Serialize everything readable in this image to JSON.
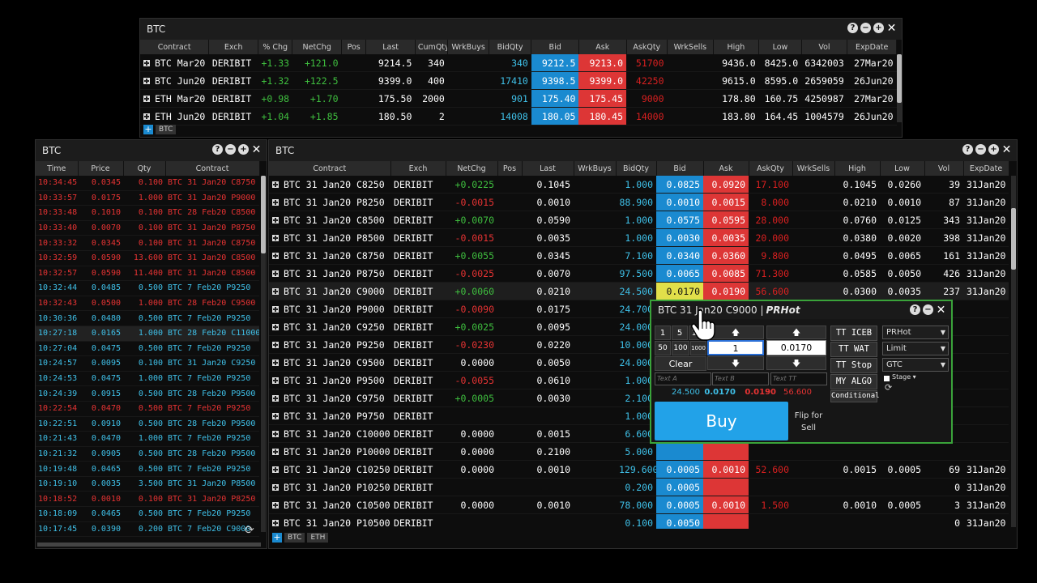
{
  "top_window": {
    "title": "BTC",
    "headers": [
      "Contract",
      "Exch",
      "% Chg",
      "NetChg",
      "Pos",
      "Last",
      "CumQty",
      "WrkBuys",
      "BidQty",
      "Bid",
      "Ask",
      "AskQty",
      "WrkSells",
      "High",
      "Low",
      "Vol",
      "ExpDate"
    ],
    "rows": [
      [
        "BTC Mar20",
        "DERIBIT",
        "+1.33",
        "+121.0",
        "",
        "9214.5",
        "340",
        "",
        "340",
        "9212.5",
        "9213.0",
        "51700",
        "",
        "9436.0",
        "8425.0",
        "6342003",
        "27Mar20"
      ],
      [
        "BTC Jun20",
        "DERIBIT",
        "+1.32",
        "+122.5",
        "",
        "9399.0",
        "400",
        "",
        "17410",
        "9398.5",
        "9399.0",
        "42250",
        "",
        "9615.0",
        "8595.0",
        "2659059",
        "26Jun20"
      ],
      [
        "ETH Mar20",
        "DERIBIT",
        "+0.98",
        "+1.70",
        "",
        "175.50",
        "2000",
        "",
        "901",
        "175.40",
        "175.45",
        "9000",
        "",
        "178.80",
        "160.75",
        "4250987",
        "27Mar20"
      ],
      [
        "ETH Jun20",
        "DERIBIT",
        "+1.04",
        "+1.85",
        "",
        "180.50",
        "2",
        "",
        "14008",
        "180.05",
        "180.45",
        "14000",
        "",
        "183.80",
        "164.45",
        "1004579",
        "26Jun20"
      ]
    ],
    "tabs": [
      "BTC"
    ]
  },
  "trades_window": {
    "title": "BTC",
    "headers": [
      "Time",
      "Price",
      "Qty",
      "Contract"
    ],
    "rows": [
      [
        "10:34:45",
        "0.0345",
        "0.100",
        "BTC 31 Jan20 C8750",
        "red"
      ],
      [
        "10:33:57",
        "0.0175",
        "1.000",
        "BTC 31 Jan20 P9000",
        "red"
      ],
      [
        "10:33:48",
        "0.1010",
        "0.100",
        "BTC 28 Feb20 C8500",
        "red"
      ],
      [
        "10:33:40",
        "0.0070",
        "0.100",
        "BTC 31 Jan20 P8750",
        "red"
      ],
      [
        "10:33:32",
        "0.0345",
        "0.100",
        "BTC 31 Jan20 C8750",
        "red"
      ],
      [
        "10:32:59",
        "0.0590",
        "13.600",
        "BTC 31 Jan20 C8500",
        "red"
      ],
      [
        "10:32:57",
        "0.0590",
        "11.400",
        "BTC 31 Jan20 C8500",
        "red"
      ],
      [
        "10:32:44",
        "0.0485",
        "0.500",
        "BTC 7 Feb20 P9250",
        "cy"
      ],
      [
        "10:32:43",
        "0.0500",
        "1.000",
        "BTC 28 Feb20 C9500",
        "red"
      ],
      [
        "10:30:36",
        "0.0480",
        "0.500",
        "BTC 7 Feb20 P9250",
        "cy"
      ],
      [
        "10:27:18",
        "0.0165",
        "1.000",
        "BTC 28 Feb20 C11000",
        "cy"
      ],
      [
        "10:27:04",
        "0.0475",
        "0.500",
        "BTC 7 Feb20 P9250",
        "cy"
      ],
      [
        "10:24:57",
        "0.0095",
        "0.100",
        "BTC 31 Jan20 C9250",
        "cy"
      ],
      [
        "10:24:53",
        "0.0475",
        "1.000",
        "BTC 7 Feb20 P9250",
        "cy"
      ],
      [
        "10:24:39",
        "0.0915",
        "0.500",
        "BTC 28 Feb20 P9500",
        "cy"
      ],
      [
        "10:22:54",
        "0.0470",
        "0.500",
        "BTC 7 Feb20 P9250",
        "red"
      ],
      [
        "10:22:51",
        "0.0910",
        "0.500",
        "BTC 28 Feb20 P9500",
        "cy"
      ],
      [
        "10:21:43",
        "0.0470",
        "1.000",
        "BTC 7 Feb20 P9250",
        "cy"
      ],
      [
        "10:21:32",
        "0.0905",
        "0.500",
        "BTC 28 Feb20 P9500",
        "cy"
      ],
      [
        "10:19:48",
        "0.0465",
        "0.500",
        "BTC 7 Feb20 P9250",
        "cy"
      ],
      [
        "10:19:10",
        "0.0035",
        "3.500",
        "BTC 31 Jan20 P8500",
        "cy"
      ],
      [
        "10:18:52",
        "0.0010",
        "0.100",
        "BTC 31 Jan20 P8250",
        "red"
      ],
      [
        "10:18:09",
        "0.0465",
        "0.500",
        "BTC 7 Feb20 P9250",
        "cy"
      ],
      [
        "10:17:45",
        "0.0390",
        "0.200",
        "BTC 7 Feb20 C9000",
        "cy"
      ]
    ]
  },
  "options_window": {
    "title": "BTC",
    "headers": [
      "Contract",
      "Exch",
      "NetChg",
      "Pos",
      "Last",
      "WrkBuys",
      "BidQty",
      "Bid",
      "Ask",
      "AskQty",
      "WrkSells",
      "High",
      "Low",
      "Vol",
      "ExpDate"
    ],
    "rows": [
      [
        "BTC 31 Jan20 C8250",
        "DERIBIT",
        "+0.0225",
        "",
        "0.1045",
        "",
        "1.000",
        "0.0825",
        "0.0920",
        "17.100",
        "",
        "0.1045",
        "0.0260",
        "39",
        "31Jan20"
      ],
      [
        "BTC 31 Jan20 P8250",
        "DERIBIT",
        "-0.0015",
        "",
        "0.0010",
        "",
        "88.900",
        "0.0010",
        "0.0015",
        "8.000",
        "",
        "0.0210",
        "0.0010",
        "87",
        "31Jan20"
      ],
      [
        "BTC 31 Jan20 C8500",
        "DERIBIT",
        "+0.0070",
        "",
        "0.0590",
        "",
        "1.000",
        "0.0575",
        "0.0595",
        "28.000",
        "",
        "0.0760",
        "0.0125",
        "343",
        "31Jan20"
      ],
      [
        "BTC 31 Jan20 P8500",
        "DERIBIT",
        "-0.0015",
        "",
        "0.0035",
        "",
        "1.000",
        "0.0030",
        "0.0035",
        "20.000",
        "",
        "0.0380",
        "0.0020",
        "398",
        "31Jan20"
      ],
      [
        "BTC 31 Jan20 C8750",
        "DERIBIT",
        "+0.0055",
        "",
        "0.0345",
        "",
        "7.100",
        "0.0340",
        "0.0360",
        "9.800",
        "",
        "0.0495",
        "0.0065",
        "161",
        "31Jan20"
      ],
      [
        "BTC 31 Jan20 P8750",
        "DERIBIT",
        "-0.0025",
        "",
        "0.0070",
        "",
        "97.500",
        "0.0065",
        "0.0085",
        "71.300",
        "",
        "0.0585",
        "0.0050",
        "426",
        "31Jan20"
      ],
      [
        "BTC 31 Jan20 C9000",
        "DERIBIT",
        "+0.0060",
        "",
        "0.0210",
        "",
        "24.500",
        "0.0170",
        "0.0190",
        "56.600",
        "",
        "0.0300",
        "0.0035",
        "237",
        "31Jan20"
      ],
      [
        "BTC 31 Jan20 P9000",
        "DERIBIT",
        "-0.0090",
        "",
        "0.0175",
        "",
        "24.700",
        "",
        "",
        "",
        "",
        "",
        "",
        "",
        ""
      ],
      [
        "BTC 31 Jan20 C9250",
        "DERIBIT",
        "+0.0025",
        "",
        "0.0095",
        "",
        "24.000",
        "",
        "",
        "",
        "",
        "",
        "",
        "",
        ""
      ],
      [
        "BTC 31 Jan20 P9250",
        "DERIBIT",
        "-0.0230",
        "",
        "0.0220",
        "",
        "10.000",
        "",
        "",
        "",
        "",
        "",
        "",
        "",
        ""
      ],
      [
        "BTC 31 Jan20 C9500",
        "DERIBIT",
        "0.0000",
        "",
        "0.0050",
        "",
        "24.000",
        "",
        "",
        "",
        "",
        "",
        "",
        "",
        ""
      ],
      [
        "BTC 31 Jan20 P9500",
        "DERIBIT",
        "-0.0055",
        "",
        "0.0610",
        "",
        "1.000",
        "",
        "",
        "",
        "",
        "",
        "",
        "",
        ""
      ],
      [
        "BTC 31 Jan20 C9750",
        "DERIBIT",
        "+0.0005",
        "",
        "0.0030",
        "",
        "2.100",
        "",
        "",
        "",
        "",
        "",
        "",
        "",
        ""
      ],
      [
        "BTC 31 Jan20 P9750",
        "DERIBIT",
        "",
        "",
        "",
        "",
        "1.000",
        "",
        "",
        "",
        "",
        "",
        "",
        "",
        ""
      ],
      [
        "BTC 31 Jan20 C10000",
        "DERIBIT",
        "0.0000",
        "",
        "0.0015",
        "",
        "6.600",
        "",
        "",
        "",
        "",
        "",
        "",
        "",
        ""
      ],
      [
        "BTC 31 Jan20 P10000",
        "DERIBIT",
        "0.0000",
        "",
        "0.2100",
        "",
        "5.000",
        "",
        "",
        "",
        "",
        "",
        "",
        "",
        ""
      ],
      [
        "BTC 31 Jan20 C10250",
        "DERIBIT",
        "0.0000",
        "",
        "0.0010",
        "",
        "129.600",
        "0.0005",
        "0.0010",
        "52.600",
        "",
        "0.0015",
        "0.0005",
        "69",
        "31Jan20"
      ],
      [
        "BTC 31 Jan20 P10250",
        "DERIBIT",
        "",
        "",
        "",
        "",
        "0.200",
        "0.0005",
        "",
        "",
        "",
        "",
        "",
        "0",
        "31Jan20"
      ],
      [
        "BTC 31 Jan20 C10500",
        "DERIBIT",
        "0.0000",
        "",
        "0.0010",
        "",
        "78.000",
        "0.0005",
        "0.0010",
        "1.500",
        "",
        "0.0010",
        "0.0005",
        "3",
        "31Jan20"
      ],
      [
        "BTC 31 Jan20 P10500",
        "DERIBIT",
        "",
        "",
        "",
        "",
        "0.100",
        "0.0050",
        "",
        "",
        "",
        "",
        "",
        "0",
        "31Jan20"
      ]
    ],
    "tabs": [
      "BTC",
      "ETH"
    ]
  },
  "ticket": {
    "title": "BTC 31 Jan20 C9000 | ",
    "account": "PRHot",
    "qty_presets_row1": [
      "1",
      "5",
      "10"
    ],
    "qty_presets_row2": [
      "50",
      "100",
      "1000"
    ],
    "clear": "Clear",
    "qty_value": "1",
    "price_value": "0.0170",
    "side_buttons": [
      "TT ICEB",
      "TT WAT",
      "TT Stop",
      "MY ALGO",
      "Conditional"
    ],
    "selects": [
      "PRHot",
      "Limit",
      "GTC"
    ],
    "stage_label": "Stage",
    "text_fields": [
      "Text A",
      "Text B",
      "Text TT"
    ],
    "quote": {
      "bidqty": "24.500",
      "bid": "0.0170",
      "ask": "0.0190",
      "askqty": "56.600"
    },
    "buy_label": "Buy",
    "flip_label": "Flip for Sell"
  },
  "colors": {
    "bid": "#1a8ad0",
    "ask": "#dd3636",
    "border_active": "#3aa33a"
  }
}
